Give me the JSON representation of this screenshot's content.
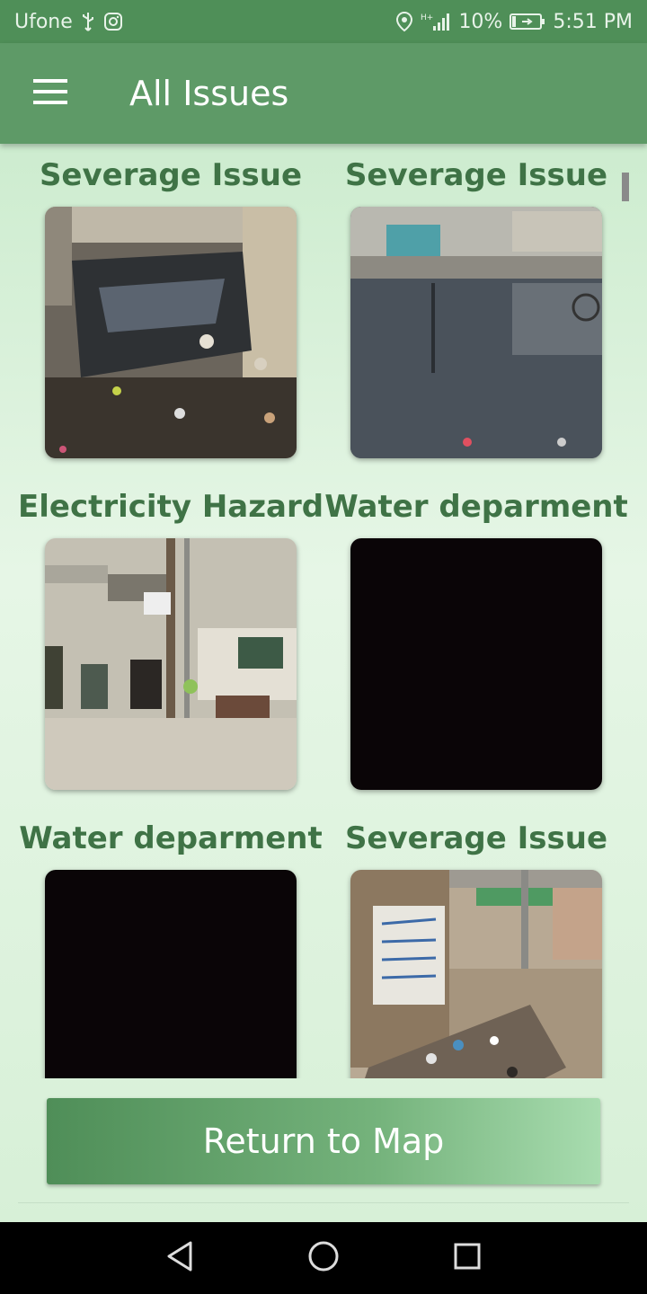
{
  "status_bar": {
    "carrier": "Ufone",
    "battery": "10%",
    "time": "5:51 PM",
    "network": "H+"
  },
  "app_bar": {
    "title": "All Issues",
    "menu_icon": "hamburger-menu-icon"
  },
  "issues": [
    {
      "title": "Severage Issue",
      "image": "flooded alley with sewage water and trash"
    },
    {
      "title": "Severage Issue",
      "image": "flooded street with reflection and garbage"
    },
    {
      "title": "Electricity Hazard",
      "image": "building with electric pole and wires"
    },
    {
      "title": "Water deparment",
      "image": "dark photo"
    },
    {
      "title": "Water deparment",
      "image": "dark photo"
    },
    {
      "title": "Severage Issue",
      "image": "street corner with garbage pile and wall writing"
    }
  ],
  "actions": {
    "return_label": "Return to Map"
  },
  "nav_bar": {
    "back_icon": "back-triangle-icon",
    "home_icon": "home-circle-icon",
    "recents_icon": "recents-square-icon"
  },
  "colors": {
    "app_bar": "#5e9a67",
    "status_bar": "#4f8f58",
    "title_text": "#3f7346",
    "content_bg": "#dff3df"
  }
}
